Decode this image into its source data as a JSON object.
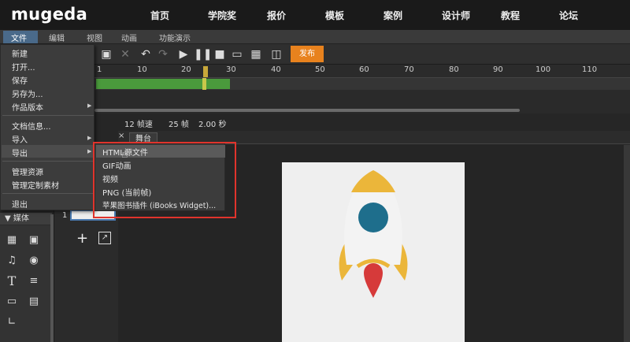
{
  "site": {
    "logo": "mugeda",
    "nav": [
      "首页",
      "学院奖",
      "报价",
      "模板",
      "案例",
      "设计师",
      "教程",
      "论坛"
    ]
  },
  "menubar": {
    "items": [
      "文件",
      "编辑",
      "视图",
      "动画",
      "功能演示"
    ]
  },
  "toolbar": {
    "publish_label": "发布",
    "icons": [
      "paste-icon",
      "cut-icon",
      "undo-icon",
      "redo-icon",
      "play-icon",
      "pause-icon",
      "stop-icon",
      "preview-icon",
      "qrcode-icon",
      "export-icon"
    ]
  },
  "timeline": {
    "ticks": [
      "1",
      "10",
      "20",
      "30",
      "40",
      "50",
      "60",
      "70",
      "80",
      "90",
      "100",
      "110"
    ],
    "current_frame": 25,
    "filled_frames": 30
  },
  "status": {
    "fps": "12 帧速",
    "frame": "25 帧",
    "seconds": "2.00 秒"
  },
  "stage": {
    "tab_label": "舞台",
    "close_glyph": "×"
  },
  "file_menu": {
    "items": [
      {
        "label": "新建",
        "arrow": false
      },
      {
        "label": "打开...",
        "arrow": false
      },
      {
        "label": "保存",
        "arrow": false
      },
      {
        "label": "另存为...",
        "arrow": false
      },
      {
        "label": "作品版本",
        "arrow": true
      },
      {
        "label": "文档信息...",
        "arrow": false
      },
      {
        "label": "导入",
        "arrow": true
      },
      {
        "label": "导出",
        "arrow": true
      },
      {
        "label": "管理资源",
        "arrow": false
      },
      {
        "label": "管理定制素材",
        "arrow": false
      },
      {
        "label": "退出",
        "arrow": false
      }
    ]
  },
  "export_menu": {
    "items": [
      "HTML源文件",
      "GIF动画",
      "视频",
      "PNG (当前帧)",
      "苹果图书插件 (iBooks Widget)..."
    ]
  },
  "left_panel": {
    "media_header": "▼ 媒体",
    "tools": [
      "grid-icon",
      "image-icon",
      "audio-icon",
      "video-icon",
      "text-icon",
      "paragraph-icon",
      "slideshow-icon",
      "code-icon",
      "chart-icon"
    ]
  },
  "scenes": {
    "number": "1",
    "add_glyph": "+"
  },
  "colors": {
    "accent": "#e8821e",
    "highlight": "#e0342c",
    "rocket_body": "#f3f3f3",
    "rocket_fins": "#ebb63a",
    "rocket_window": "#1e6e8c",
    "rocket_flame": "#d63a3a"
  }
}
